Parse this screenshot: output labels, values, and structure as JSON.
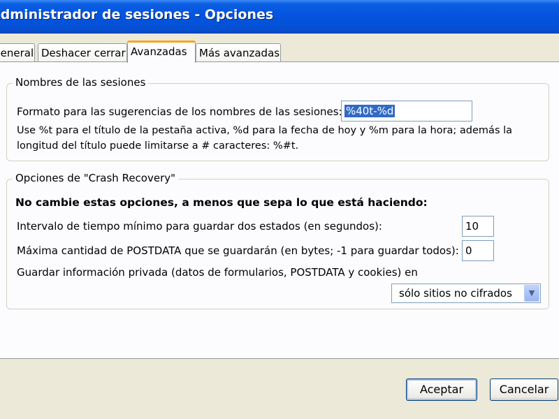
{
  "window": {
    "title": "Administrador de sesiones - Opciones"
  },
  "tabs": [
    {
      "label": "General"
    },
    {
      "label": "Deshacer cerrar"
    },
    {
      "label": "Avanzadas"
    },
    {
      "label": "Más avanzadas"
    }
  ],
  "group_names": {
    "legend": "Nombres de las sesiones",
    "format_label": "Formato para las sugerencias de los nombres de las sesiones:",
    "format_value": "%40t-%d",
    "help_line1": "Use %t para el título de la pestaña activa, %d para la fecha de hoy y %m para la hora; además la",
    "help_line2": "longitud del título puede limitarse a # caracteres: %#t."
  },
  "group_crash": {
    "legend": "Opciones de \"Crash Recovery\"",
    "warning": "No cambie estas opciones, a menos que sepa lo que está haciendo:",
    "interval_label": "Intervalo de tiempo mínimo para guardar dos estados (en segundos):",
    "interval_value": "10",
    "postdata_label": "Máxima cantidad de POSTDATA que se guardarán (en bytes; -1 para guardar todos):",
    "postdata_value": "0",
    "private_label": "Guardar información privada (datos de formularios, POSTDATA y cookies) en",
    "private_selected": "sólo sitios no cifrados"
  },
  "buttons": {
    "accept": "Aceptar",
    "cancel": "Cancelar"
  },
  "icons": {
    "dropdown": "chevron-down-icon"
  }
}
